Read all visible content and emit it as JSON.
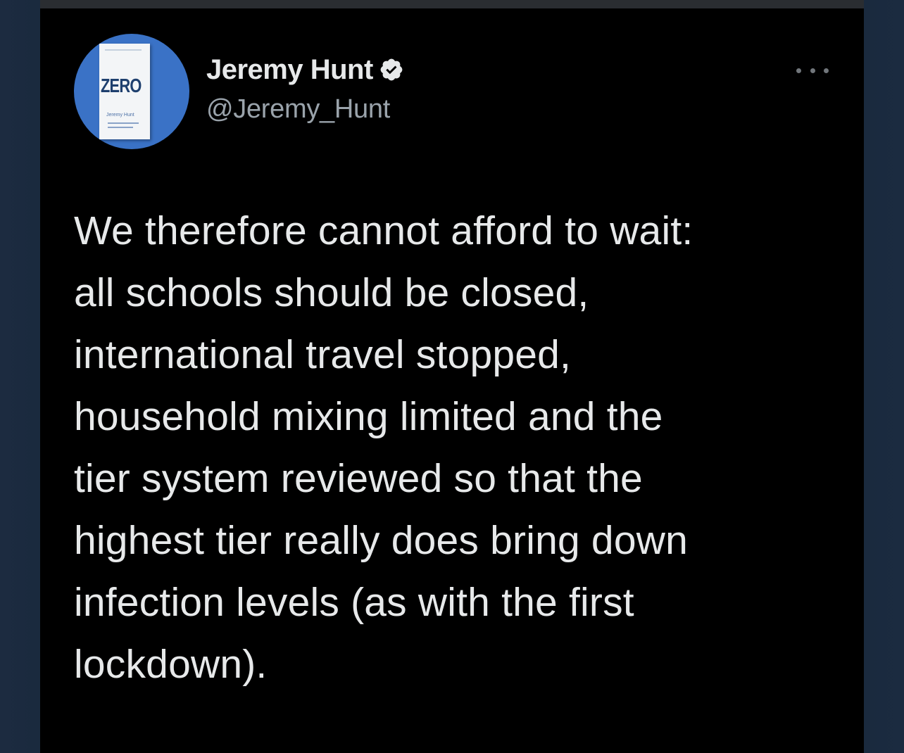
{
  "tweet": {
    "author": {
      "display_name": "Jeremy Hunt",
      "handle": "@Jeremy_Hunt",
      "verified": true,
      "avatar": {
        "icon": "book-cover-avatar",
        "book_title": "ZERO",
        "book_author": "Jeremy Hunt",
        "background_color": "#3a72c6"
      }
    },
    "more_icon": "more-horizontal-icon",
    "text": "We therefore cannot afford to wait:\nall schools should be closed,\ninternational travel stopped,\nhousehold mixing limited and the\ntier system reviewed so that the\nhighest tier really does bring down\ninfection levels (as with the first\nlockdown).",
    "meta": {
      "time": "",
      "source": ""
    }
  },
  "colors": {
    "background": "#000000",
    "side_panel": "#1b2a3d",
    "text_primary": "#e7e9ea",
    "text_secondary": "#9aa3ab",
    "verified_badge": "#e7e9ea"
  }
}
